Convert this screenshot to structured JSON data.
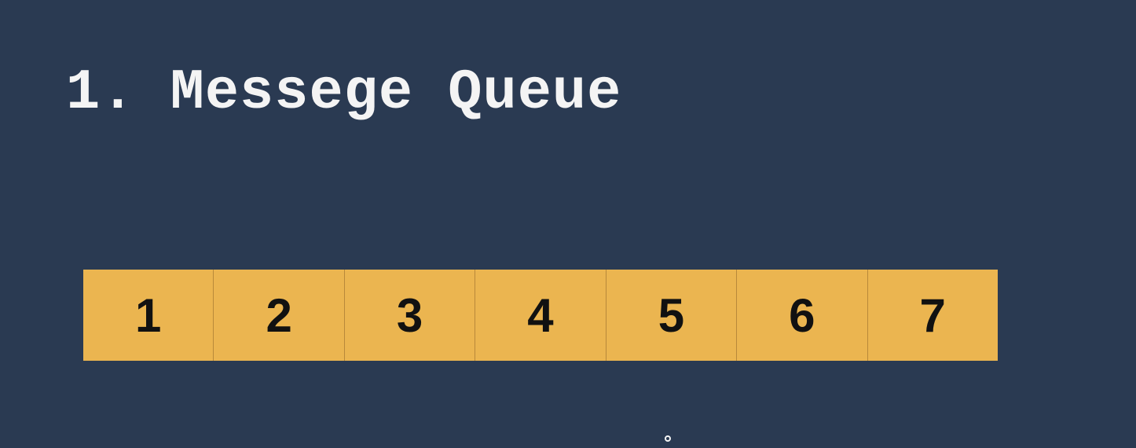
{
  "slide": {
    "title": "1. Messege Queue",
    "background_color": "#2a3a52",
    "cell_color": "#ebb550",
    "queue": {
      "items": [
        "1",
        "2",
        "3",
        "4",
        "5",
        "6",
        "7"
      ]
    },
    "cursor_icon": "pointer-cursor-icon"
  }
}
